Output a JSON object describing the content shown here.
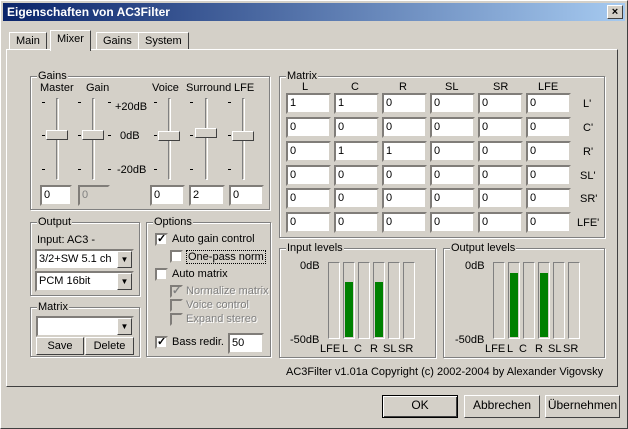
{
  "window": {
    "title": "Eigenschaften von AC3Filter",
    "close": "×"
  },
  "tabs": [
    {
      "label": "Main"
    },
    {
      "label": "Mixer"
    },
    {
      "label": "Gains"
    },
    {
      "label": "System"
    }
  ],
  "gains": {
    "group": "Gains",
    "master": "Master",
    "gain": "Gain",
    "voice": "Voice",
    "surround": "Surround",
    "lfe": "LFE",
    "scale_top": "+20dB",
    "scale_mid": "0dB",
    "scale_bot": "-20dB",
    "master_value": "0",
    "gain_value": "0",
    "voice_value": "0",
    "surround_value": "2",
    "lfe_value": "0"
  },
  "output": {
    "group": "Output",
    "input_label": "Input: AC3 -",
    "speakers": "3/2+SW 5.1 ch",
    "format": "PCM 16bit"
  },
  "matrix_preset": {
    "group": "Matrix",
    "value": "",
    "save": "Save",
    "delete": "Delete"
  },
  "options": {
    "group": "Options",
    "auto_gain": "Auto gain control",
    "one_pass": "One-pass norm",
    "auto_matrix": "Auto matrix",
    "normalize": "Normalize matrix",
    "voice_control": "Voice control",
    "expand_stereo": "Expand stereo",
    "bass_redir": "Bass redir.",
    "bass_value": "50"
  },
  "matrix": {
    "group": "Matrix",
    "cols": [
      "L",
      "C",
      "R",
      "SL",
      "SR",
      "LFE"
    ],
    "rows": [
      "L'",
      "C'",
      "R'",
      "SL'",
      "SR'",
      "LFE'"
    ],
    "values": [
      [
        "1",
        "1",
        "0",
        "0",
        "0",
        "0"
      ],
      [
        "0",
        "0",
        "0",
        "0",
        "0",
        "0"
      ],
      [
        "0",
        "1",
        "1",
        "0",
        "0",
        "0"
      ],
      [
        "0",
        "0",
        "0",
        "0",
        "0",
        "0"
      ],
      [
        "0",
        "0",
        "0",
        "0",
        "0",
        "0"
      ],
      [
        "0",
        "0",
        "0",
        "0",
        "0",
        "0"
      ]
    ]
  },
  "input_levels": {
    "group": "Input levels",
    "top": "0dB",
    "bottom": "-50dB",
    "channels": [
      "LFE",
      "L",
      "C",
      "R",
      "SL",
      "SR"
    ],
    "levels": [
      0,
      0.74,
      0,
      0.74,
      0,
      0
    ]
  },
  "output_levels": {
    "group": "Output levels",
    "top": "0dB",
    "bottom": "-50dB",
    "channels": [
      "LFE",
      "L",
      "C",
      "R",
      "SL",
      "SR"
    ],
    "levels": [
      0,
      0.85,
      0,
      0.85,
      0,
      0
    ]
  },
  "copyright": "AC3Filter v1.01a Copyright (c) 2002-2004 by Alexander Vigovsky",
  "buttons": {
    "ok": "OK",
    "cancel": "Abbrechen",
    "apply": "Übernehmen"
  }
}
